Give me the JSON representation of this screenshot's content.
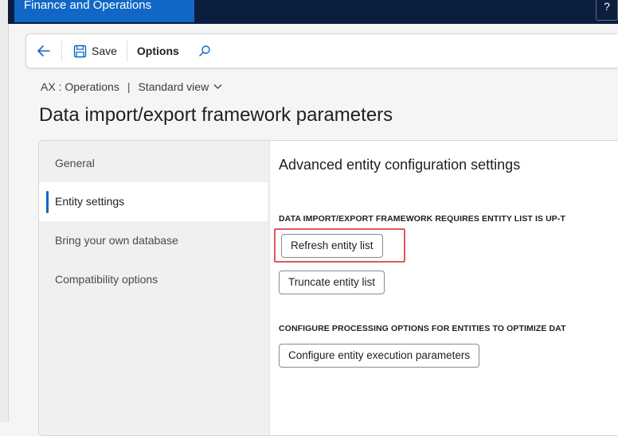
{
  "topbar": {
    "app_name": "Finance and Operations",
    "right_control": "?"
  },
  "actionpane": {
    "save_label": "Save",
    "options_label": "Options"
  },
  "breadcrumb": {
    "company": "AX : Operations",
    "separator": "|",
    "view": "Standard view"
  },
  "page": {
    "title": "Data import/export framework parameters"
  },
  "nav": {
    "items": [
      {
        "label": "General"
      },
      {
        "label": "Entity settings"
      },
      {
        "label": "Bring your own database"
      },
      {
        "label": "Compatibility options"
      }
    ],
    "selected": "Entity settings"
  },
  "content": {
    "heading": "Advanced entity configuration settings",
    "section1_label": "DATA IMPORT/EXPORT FRAMEWORK REQUIRES ENTITY LIST IS UP-T",
    "refresh_button": "Refresh entity list",
    "truncate_button": "Truncate entity list",
    "section2_label": "CONFIGURE PROCESSING OPTIONS FOR ENTITIES TO OPTIMIZE DAT",
    "configure_button": "Configure entity execution parameters"
  },
  "colors": {
    "accent": "#1167c6",
    "topbar": "#0b1e3e",
    "highlight": "#e3575d"
  }
}
